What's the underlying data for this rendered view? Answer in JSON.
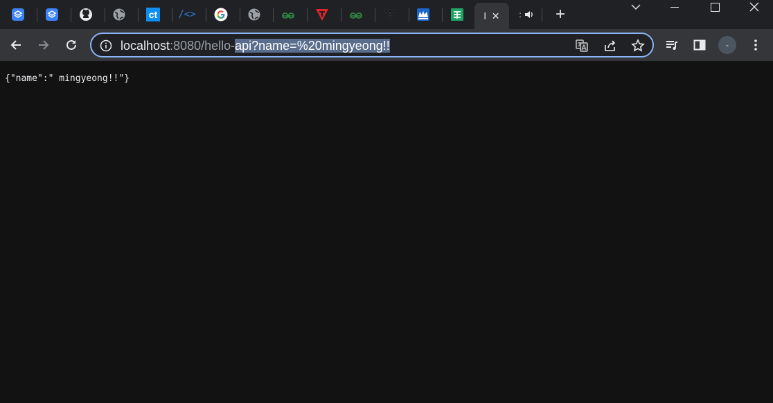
{
  "tabs": [
    {
      "icon": "stack-blue-icon"
    },
    {
      "icon": "stack-blue-icon"
    },
    {
      "icon": "github-icon"
    },
    {
      "icon": "globe-icon"
    },
    {
      "icon": "ct-icon",
      "glyph": "ct"
    },
    {
      "icon": "code-brackets-icon",
      "glyph": "/<>"
    },
    {
      "icon": "google-icon"
    },
    {
      "icon": "globe-icon"
    },
    {
      "icon": "geeksforgeeks-icon"
    },
    {
      "icon": "red-shield-icon"
    },
    {
      "icon": "geeksforgeeks-icon"
    },
    {
      "icon": "dots-icon"
    },
    {
      "icon": "crown-icon"
    },
    {
      "icon": "sheets-icon"
    }
  ],
  "active_tab": {
    "label": "l",
    "close": "✕"
  },
  "audio_tab": {
    "label": ":",
    "icon": "speaker-icon"
  },
  "new_tab": "+",
  "window_controls": {
    "minimize": "—",
    "maximize": "☐",
    "close": "✕"
  },
  "address_bar": {
    "host": "localhost",
    "port_path": ":8080/hello-",
    "selected": "api?name=%20mingyeong!!"
  },
  "page_body": "{\"name\":\" mingyeong!!\"}",
  "profile_avatar": "-",
  "colors": {
    "tab_bar": "#202124",
    "toolbar": "#35363a",
    "content": "#121212",
    "focus_ring": "#8ab4f8"
  }
}
